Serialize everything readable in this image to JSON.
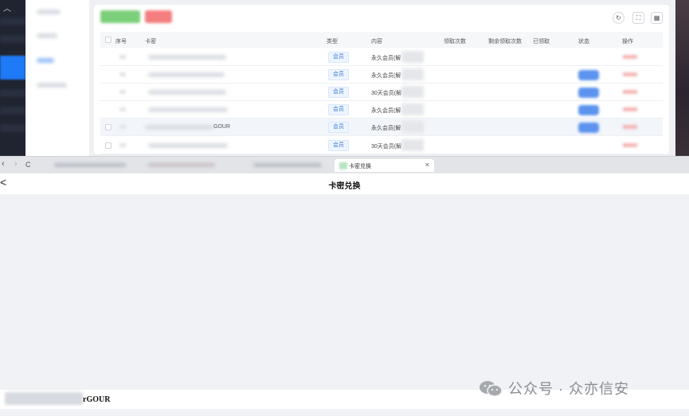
{
  "admin_panel": {
    "columns": [
      "序号",
      "卡密",
      "类型",
      "内容",
      "领取次数",
      "剩余领取次数",
      "已领取",
      "状态",
      "操作"
    ],
    "rows": [
      {
        "type": "会员",
        "content": "永久会员(解",
        "key_suffix": "",
        "highlighted": false
      },
      {
        "type": "会员",
        "content": "永久会员(解",
        "key_suffix": "",
        "highlighted": false
      },
      {
        "type": "会员",
        "content": "30天会员(解",
        "key_suffix": "",
        "highlighted": false
      },
      {
        "type": "会员",
        "content": "永久会员(解",
        "key_suffix": "",
        "highlighted": false
      },
      {
        "type": "会员",
        "content": "永久会员(解",
        "key_suffix": "GOUR",
        "highlighted": true
      },
      {
        "type": "会员",
        "content": "30天会员(解",
        "key_suffix": "",
        "highlighted": false
      }
    ],
    "tools": {
      "refresh": "↻",
      "fullscreen": "⛶",
      "columns": "▦"
    },
    "colors": {
      "primary": "#1f7af8",
      "success_btn": "#6cc76e",
      "danger_btn": "#f26f6f"
    }
  },
  "browser": {
    "active_tab_label": "卡密兑换",
    "close_glyph": "×",
    "back_glyph": "‹",
    "forward_glyph": "›",
    "reload_glyph": "C"
  },
  "redeem_page": {
    "title": "卡密兑换",
    "back_glyph": "<",
    "code_suffix": "rGOUR"
  },
  "watermark": {
    "text": "公众号 · 众亦信安"
  }
}
